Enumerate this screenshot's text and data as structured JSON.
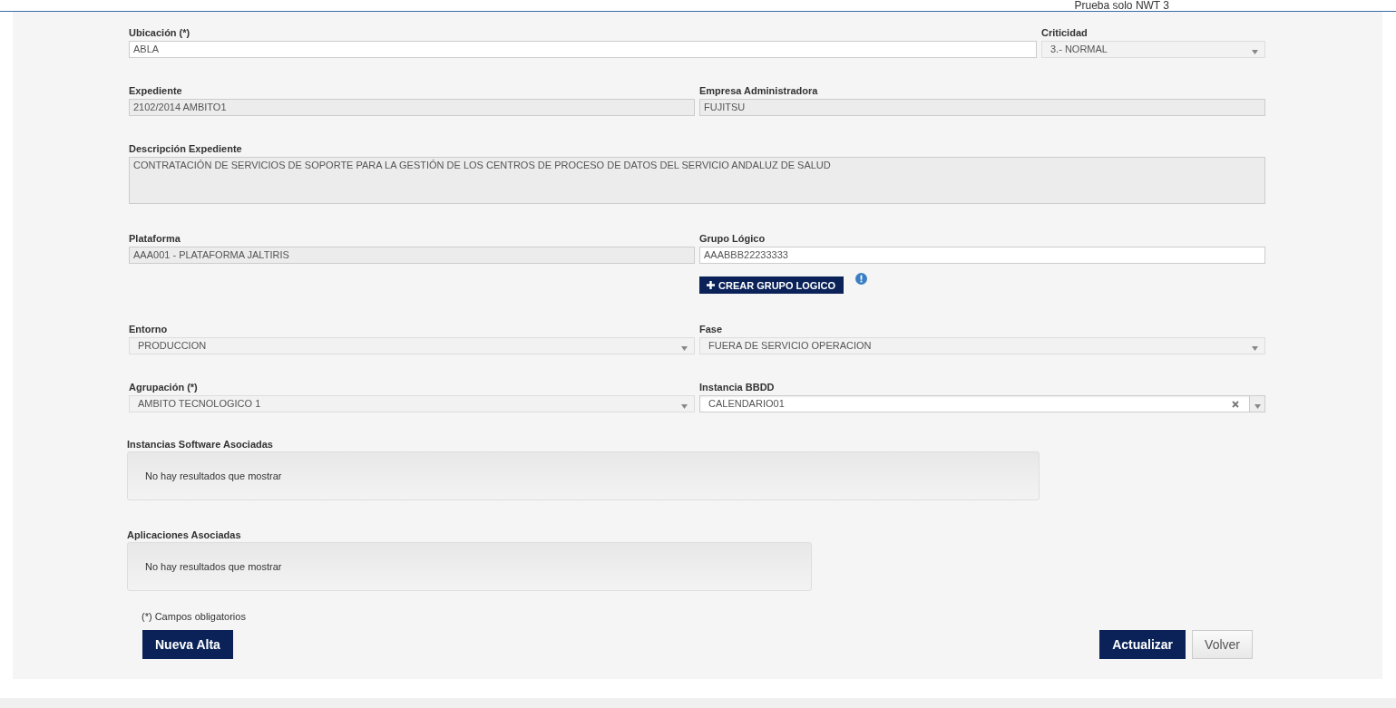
{
  "header_text": "Prueba solo NWT 3",
  "rows": [
    {
      "fields": [
        {
          "label": "Ubicación (*)",
          "value": "ABLA",
          "kind": "text"
        },
        {
          "label": "Criticidad",
          "value": "3.- NORMAL",
          "kind": "select"
        }
      ]
    },
    {
      "fields": [
        {
          "label": "Expediente",
          "value": "2102/2014 AMBITO1",
          "kind": "readonly"
        },
        {
          "label": "Empresa Administradora",
          "value": "FUJITSU",
          "kind": "readonly"
        }
      ]
    },
    {
      "fields": [
        {
          "label": "Descripción Expediente",
          "value": "CONTRATACIÓN DE SERVICIOS DE SOPORTE PARA LA GESTIÓN DE LOS CENTROS DE PROCESO DE DATOS DEL SERVICIO ANDALUZ DE SALUD",
          "kind": "textarea"
        }
      ]
    },
    {
      "fields": [
        {
          "label": "Plataforma",
          "value": "AAA001 - PLATAFORMA JALTIRIS",
          "kind": "readonly"
        },
        {
          "label": "Grupo Lógico",
          "value": "AAABBB22233333",
          "kind": "text",
          "button": "CREAR GRUPO LOGICO"
        }
      ]
    },
    {
      "fields": [
        {
          "label": "Entorno",
          "value": "PRODUCCION",
          "kind": "select"
        },
        {
          "label": "Fase",
          "value": "FUERA DE SERVICIO OPERACION",
          "kind": "select"
        }
      ]
    },
    {
      "fields": [
        {
          "label": "Agrupación (*)",
          "value": "AMBITO TECNOLOGICO 1",
          "kind": "select"
        },
        {
          "label": "Instancia BBDD",
          "value": "CALENDARIO01",
          "kind": "select-clearable"
        }
      ]
    }
  ],
  "associations": [
    {
      "title": "Instancias Software Asociadas",
      "empty_text": "No hay resultados que mostrar"
    },
    {
      "title": "Aplicaciones Asociadas",
      "empty_text": "No hay resultados que mostrar"
    }
  ],
  "note": "(*) Campos obligatorios",
  "buttons": [
    {
      "label": "Nueva Alta",
      "kind": "primary"
    },
    {
      "label": "Actualizar",
      "kind": "primary"
    },
    {
      "label": "Volver",
      "kind": "secondary"
    }
  ]
}
